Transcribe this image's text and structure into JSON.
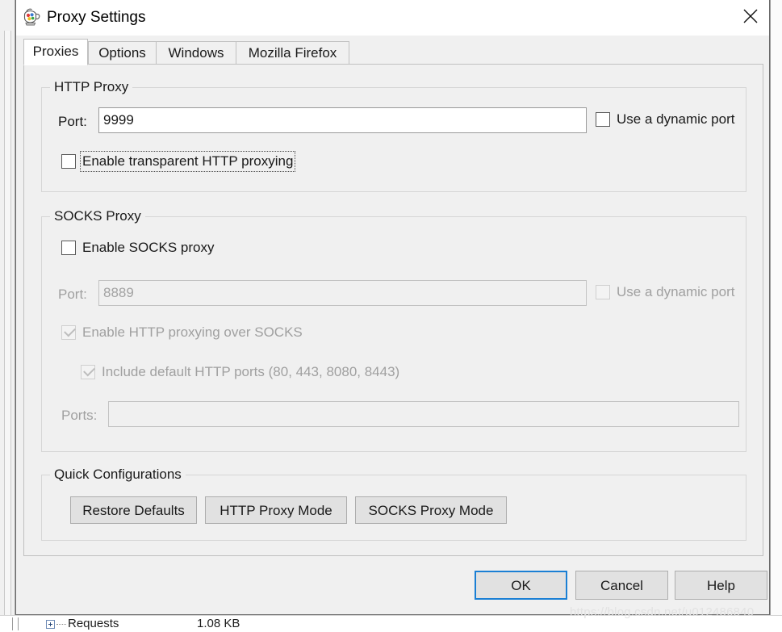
{
  "background_window": {
    "row_label": "Requests",
    "row_size": "1.08 KB",
    "expander_icon": "plus-box-icon"
  },
  "watermark": {
    "text": "https://blog.csdn.net/u012486840"
  },
  "dialog": {
    "title": "Proxy Settings",
    "icon": "fiddler-teapot-icon",
    "close_icon": "close-icon"
  },
  "tabs": [
    {
      "label": "Proxies",
      "selected": true
    },
    {
      "label": "Options",
      "selected": false
    },
    {
      "label": "Windows",
      "selected": false
    },
    {
      "label": "Mozilla Firefox",
      "selected": false
    }
  ],
  "http_proxy": {
    "group_title": "HTTP Proxy",
    "port_label": "Port:",
    "port_value": "9999",
    "dynamic_port_label": "Use a dynamic port",
    "dynamic_port_checked": false,
    "transparent_label": "Enable transparent HTTP proxying",
    "transparent_checked": false
  },
  "socks_proxy": {
    "group_title": "SOCKS Proxy",
    "enable_label": "Enable SOCKS proxy",
    "enable_checked": false,
    "port_label": "Port:",
    "port_value": "8889",
    "dynamic_port_label": "Use a dynamic port",
    "dynamic_port_checked": false,
    "http_over_socks_label": "Enable HTTP proxying over SOCKS",
    "http_over_socks_checked": true,
    "include_default_ports_label": "Include default HTTP ports (80, 443, 8080, 8443)",
    "include_default_ports_checked": true,
    "ports_label": "Ports:",
    "ports_value": ""
  },
  "quick_configurations": {
    "group_title": "Quick Configurations",
    "buttons": [
      {
        "label": "Restore Defaults"
      },
      {
        "label": "HTTP Proxy Mode"
      },
      {
        "label": "SOCKS Proxy Mode"
      }
    ]
  },
  "dialog_buttons": [
    {
      "label": "OK",
      "default": true
    },
    {
      "label": "Cancel",
      "default": false
    },
    {
      "label": "Help",
      "default": false
    }
  ],
  "colors": {
    "accent_focus": "#1a7fd4",
    "dialog_background": "#f0f0f0",
    "panel_border": "#c0c0c0",
    "group_border": "#d6d6d6",
    "disabled_text": "#a0a0a0"
  }
}
